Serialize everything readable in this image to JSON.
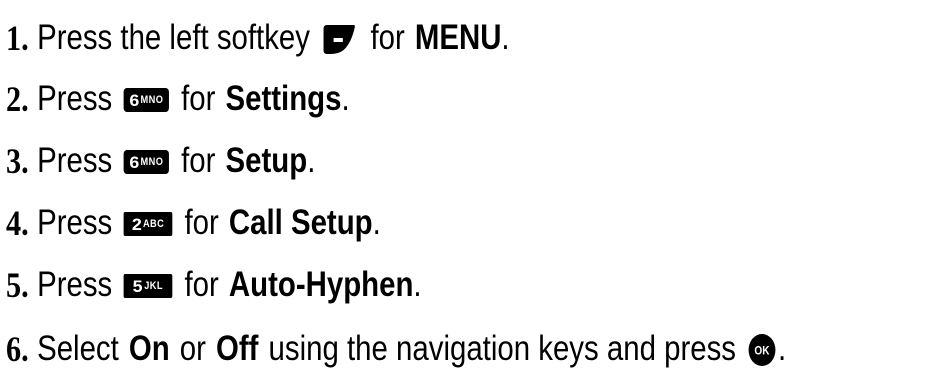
{
  "steps": [
    {
      "number": "1.",
      "pre": "Press the left softkey",
      "key_icon": "left-softkey-icon",
      "post": "for",
      "target": "MENU",
      "end": "."
    },
    {
      "number": "2.",
      "pre": "Press",
      "key_digit": "6",
      "key_letters": "MNO",
      "key_icon": "key-6-icon",
      "post": "for",
      "target": "Settings",
      "end": "."
    },
    {
      "number": "3.",
      "pre": "Press",
      "key_digit": "6",
      "key_letters": "MNO",
      "key_icon": "key-6-icon",
      "post": "for",
      "target": "Setup",
      "end": "."
    },
    {
      "number": "4.",
      "pre": "Press",
      "key_digit": "2",
      "key_letters": "ABC",
      "key_icon": "key-2-icon",
      "post": "for",
      "target": "Call Setup",
      "end": "."
    },
    {
      "number": "5.",
      "pre": "Press",
      "key_digit": "5",
      "key_letters": "JKL",
      "key_icon": "key-5-icon",
      "post": "for",
      "target": "Auto-Hyphen",
      "end": "."
    },
    {
      "number": "6.",
      "pre": "Select",
      "option_on": "On",
      "or": "or",
      "option_off": "Off",
      "mid": "using the navigation keys and press",
      "key_icon": "ok-key-icon",
      "ok_label": "OK",
      "end": "."
    }
  ]
}
